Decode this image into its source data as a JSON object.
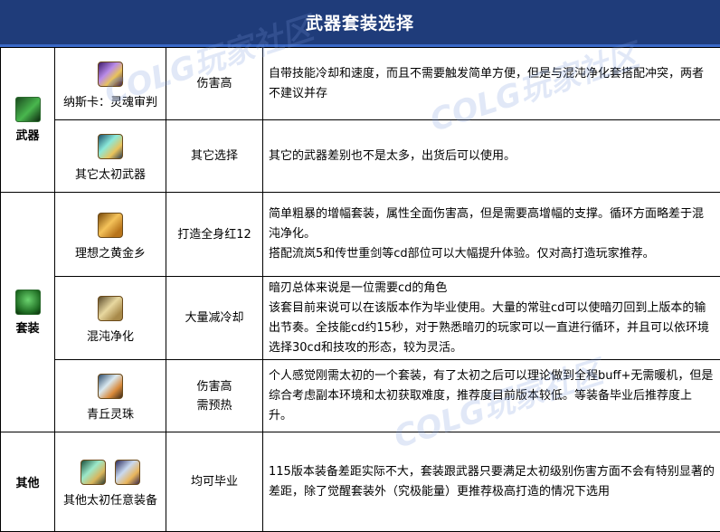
{
  "title": "武器套装选择",
  "watermark": "COLG玩家社区",
  "colors": {
    "header_bg": "#1f3c7a",
    "header_accent": "#3a69c7",
    "border": "#000000"
  },
  "sections": [
    {
      "category": "武器",
      "category_icon": "weapon-icon",
      "rows": [
        {
          "item": "纳斯卡：灵魂审判",
          "icon": "naska-weapon-icon",
          "eval": "伤害高",
          "desc": "自带技能冷却和速度，而且不需要触发简单方便，但是与混沌净化套搭配冲突，两者不建议并存"
        },
        {
          "item": "其它太初武器",
          "icon": "primordial-weapon-icon",
          "eval": "其它选择",
          "desc": "其它的武器差别也不是太多，出货后可以使用。"
        }
      ]
    },
    {
      "category": "套装",
      "category_icon": "armor-set-icon",
      "rows": [
        {
          "item": "理想之黄金乡",
          "icon": "golden-armor-icon",
          "eval": "打造全身红12",
          "desc": "简单粗暴的增幅套装，属性全面伤害高，但是需要高增幅的支撑。循环方面略差于混沌净化。\n搭配流岚5和传世重剑等cd部位可以大幅提升体验。仅对高打造玩家推荐。"
        },
        {
          "item": "混沌净化",
          "icon": "chaos-armor-icon",
          "eval": "大量减冷却",
          "desc": "暗刃总体来说是一位需要cd的角色\n该套目前来说可以在该版本作为毕业使用。大量的常驻cd可以使暗刃回到上版本的输出节奏。全技能cd约15秒，对于熟悉暗刃的玩家可以一直进行循环，并且可以依环境选择30cd和技攻的形态，较为灵活。"
        },
        {
          "item": "青丘灵珠",
          "icon": "qingqiu-armor-icon",
          "eval": "伤害高\n需预热",
          "desc": "个人感觉刚需太初的一个套装，有了太初之后可以理论做到全程buff+无需暖机，但是综合考虑副本环境和太初获取难度，推荐度目前版本较低。等装备毕业后推荐度上升。"
        }
      ]
    },
    {
      "category": "其他",
      "category_icon": "",
      "rows": [
        {
          "item": "其他太初任意装备",
          "icon": "other-gear-icon",
          "eval": "均可毕业",
          "desc": "115版本装备差距实际不大，套装跟武器只要满足太初级别伤害方面不会有特别显著的差距，除了觉醒套装外（究极能量）更推荐极高打造的情况下选用"
        }
      ]
    }
  ]
}
